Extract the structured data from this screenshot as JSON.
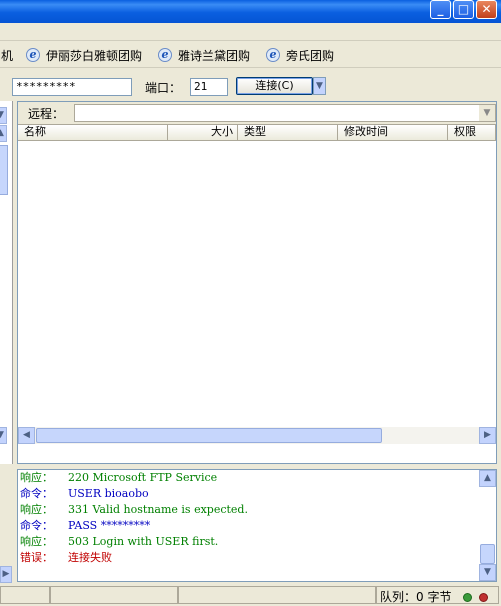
{
  "titlebar": {
    "buttons": [
      "_",
      "□",
      "✕"
    ]
  },
  "favorites": {
    "partial_label": "机",
    "items": [
      {
        "icon": "ie-icon",
        "label": "伊丽莎白雅顿团购"
      },
      {
        "icon": "ie-icon",
        "label": "雅诗兰黛团购"
      },
      {
        "icon": "ie-icon",
        "label": "旁氏团购"
      }
    ]
  },
  "connection": {
    "password_value": "*********",
    "port_label": "端口：",
    "port_value": "21",
    "connect_button": "连接(C)"
  },
  "remote": {
    "label": "远程：",
    "columns": [
      "名称",
      "大小",
      "类型",
      "修改时间",
      "权限"
    ]
  },
  "log": [
    {
      "label": "响应：",
      "text": "220 Microsoft FTP Service",
      "kind": "response"
    },
    {
      "label": "命令：",
      "text": "USER bioaobo",
      "kind": "command"
    },
    {
      "label": "响应：",
      "text": "331 Valid hostname is expected.",
      "kind": "response"
    },
    {
      "label": "命令：",
      "text": "PASS *********",
      "kind": "command"
    },
    {
      "label": "响应：",
      "text": "503 Login with USER first.",
      "kind": "response"
    },
    {
      "label": "错误：",
      "text": "连接失败",
      "kind": "error"
    }
  ],
  "colors": {
    "response": "#008000",
    "command": "#0000c0",
    "error": "#c00000"
  },
  "status": {
    "queue_label": "队列：0 字节"
  }
}
